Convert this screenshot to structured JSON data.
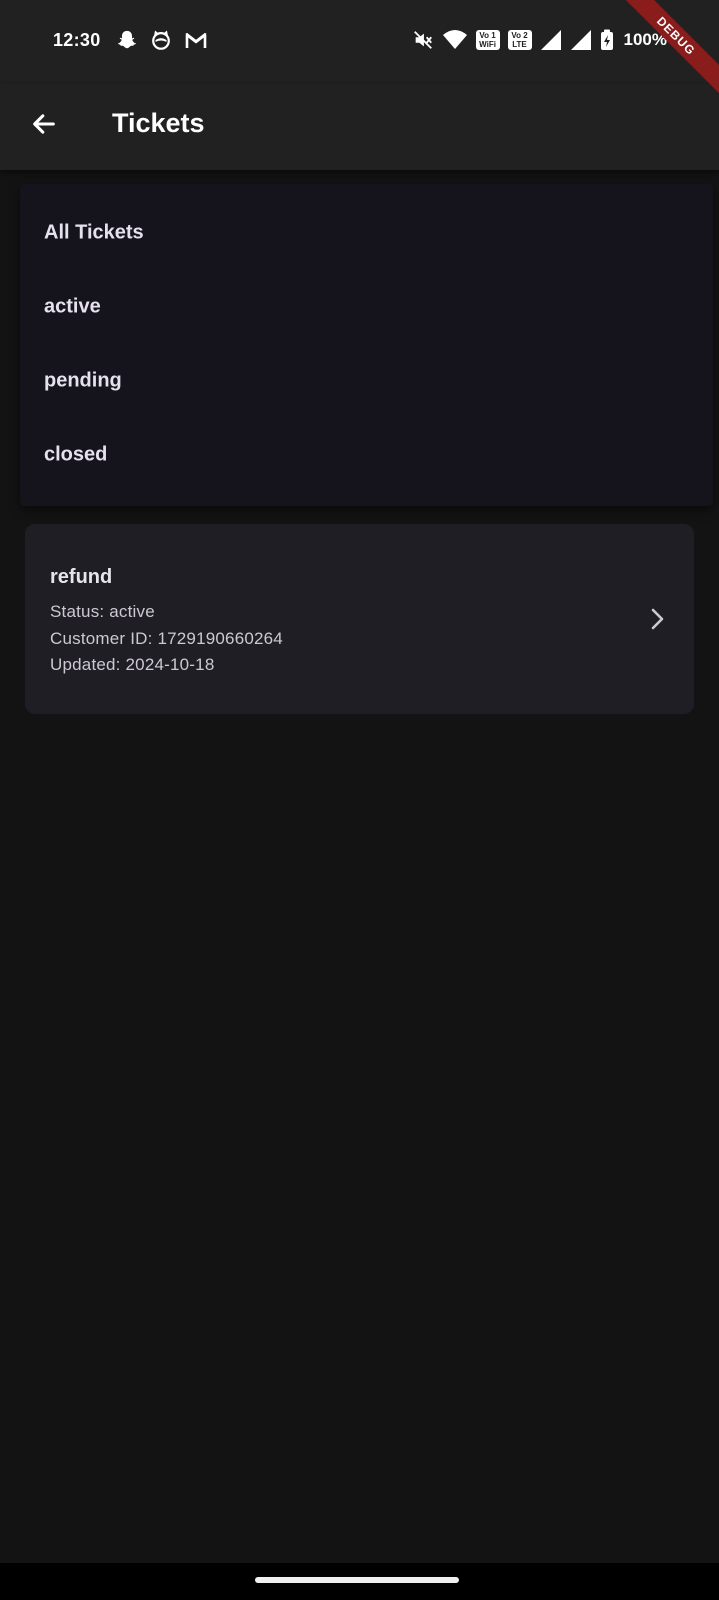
{
  "status_bar": {
    "time": "12:30",
    "left_icons": [
      "snapchat-icon",
      "cat-face-icon",
      "gmail-icon"
    ],
    "right_icons": [
      "mute-icon",
      "wifi-icon",
      "vowifi-1-badge",
      "volte-2-badge",
      "signal-icon",
      "signal-icon",
      "battery-charging-icon"
    ],
    "vowifi_badge": "Vo 1\nWiFi",
    "volte_badge": "Vo 2\nLTE",
    "battery": "100%"
  },
  "debug_banner": "DEBUG",
  "app_bar": {
    "title": "Tickets",
    "back_icon": "arrow-left-icon"
  },
  "filter_menu": {
    "items": [
      {
        "label": "All Tickets"
      },
      {
        "label": "active"
      },
      {
        "label": "pending"
      },
      {
        "label": "closed"
      }
    ]
  },
  "tickets": [
    {
      "subject": "refund",
      "status_line": "Status: active",
      "customer_line": "Customer ID: 1729190660264",
      "updated_line": "Updated: 2024-10-18",
      "trailing_icon": "chevron-right-icon"
    }
  ],
  "colors": {
    "background": "#131313",
    "app_bar": "#212121",
    "menu_surface": "#15131b",
    "card_surface": "#1f1e24",
    "debug_ribbon": "#8b1c1c"
  }
}
